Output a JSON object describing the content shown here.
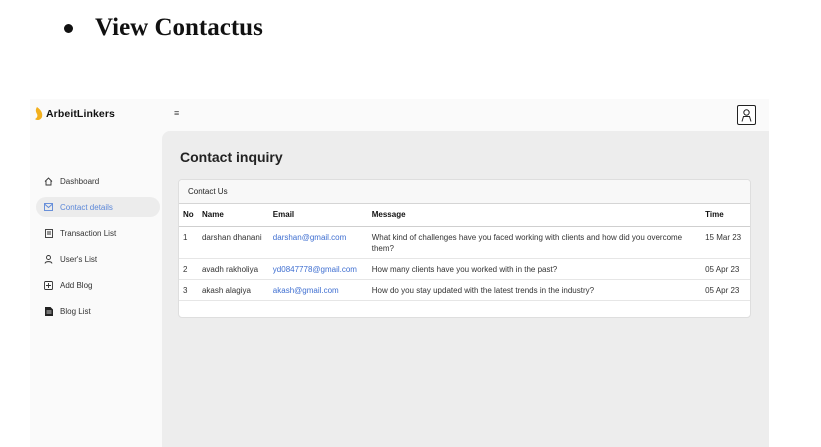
{
  "doc": {
    "title": "View Contactus"
  },
  "brand": {
    "name": "ArbeitLinkers"
  },
  "header": {
    "menu_icon": "≡"
  },
  "sidebar": {
    "items": [
      {
        "label": "Dashboard",
        "icon": "home-icon"
      },
      {
        "label": "Contact details",
        "icon": "mail-icon",
        "active": true
      },
      {
        "label": "Transaction List",
        "icon": "document-icon"
      },
      {
        "label": "User's List",
        "icon": "user-icon"
      },
      {
        "label": "Add Blog",
        "icon": "plus-square-icon"
      },
      {
        "label": "Blog List",
        "icon": "blog-icon"
      }
    ]
  },
  "main": {
    "title": "Contact inquiry",
    "card_title": "Contact Us",
    "columns": [
      "No",
      "Name",
      "Email",
      "Message",
      "Time"
    ],
    "rows": [
      {
        "no": "1",
        "name": "darshan dhanani",
        "email": "darshan@gmail.com",
        "message": "What kind of challenges have you faced working with clients and how did you overcome them?",
        "time": "15 Mar 23"
      },
      {
        "no": "2",
        "name": "avadh rakholiya",
        "email": "yd0847778@gmail.com",
        "message": "How many clients have you worked with in the past?",
        "time": "05 Apr 23"
      },
      {
        "no": "3",
        "name": "akash alagiya",
        "email": "akash@gmail.com",
        "message": "How do you stay updated with the latest trends in the industry?",
        "time": "05 Apr 23"
      }
    ]
  },
  "colors": {
    "accent": "#5b87d8",
    "link": "#3f6fd1",
    "logo": "#f2b01e"
  }
}
